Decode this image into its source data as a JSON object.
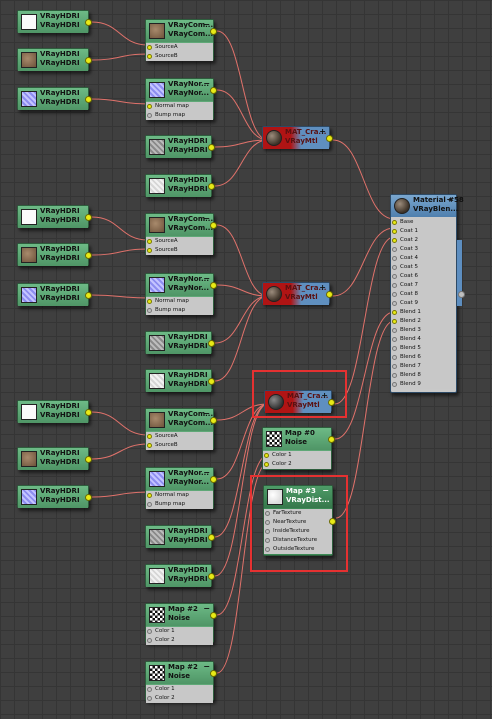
{
  "labels": {
    "vray_hdri": "VRayHDRI",
    "vray_comp_t1": "VRayCom...",
    "vray_comp_t2": "VRayCom...",
    "vray_normal_t1": "VRayNor...",
    "vray_normal_t2": "VRayNor...",
    "mtl_t1": "MAT_Cra...",
    "mtl_t2": "VRayMtl",
    "noise_map0": "Map #0",
    "noise_map2": "Map #2",
    "noise": "Noise",
    "map3": "Map #3",
    "vraydist": "VRayDist...",
    "blend_title1": "Material #58",
    "blend_title2": "VRayBlen...",
    "collapse": "−",
    "expand": "+"
  },
  "slots": {
    "sourceA": "SourceA",
    "sourceB": "SourceB",
    "normal_map": "Normal map",
    "bump_map": "Bump map",
    "color1": "Color 1",
    "color2": "Color 2",
    "far_texture": "FarTexture",
    "near_texture": "NearTexture",
    "inside_texture": "InsideTexture",
    "distance_texture": "DistanceTexture",
    "outside_texture": "OutsideTexture"
  },
  "blend_slots": [
    "Base",
    "Coat 1",
    "Coat 2",
    "Coat 3",
    "Coat 4",
    "Coat 5",
    "Coat 6",
    "Coat 7",
    "Coat 8",
    "Coat 9",
    "Blend 1",
    "Blend 2",
    "Blend 3",
    "Blend 4",
    "Blend 5",
    "Blend 6",
    "Blend 7",
    "Blend 8",
    "Blend 9"
  ],
  "colors": {
    "wire": "#e1726b",
    "node_green": "#5fa877",
    "node_blue": "#5f8fbf",
    "material_red": "#b01414",
    "socket": "#e8ea16",
    "highlight": "#e53131"
  }
}
